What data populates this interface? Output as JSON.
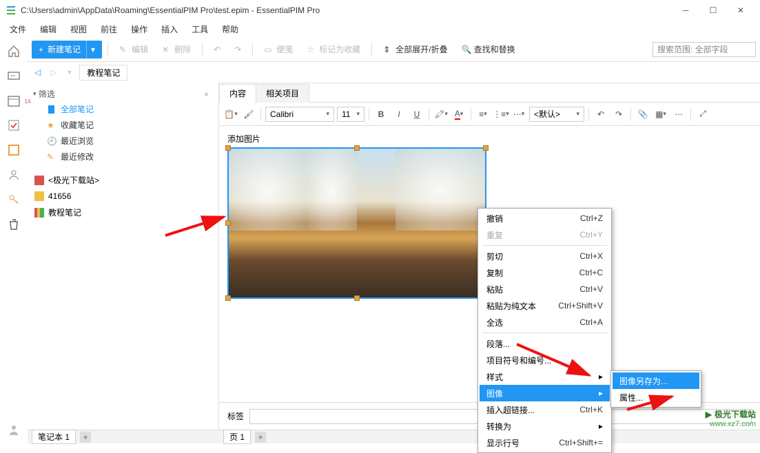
{
  "window": {
    "title": "C:\\Users\\admin\\AppData\\Roaming\\EssentialPIM Pro\\test.epim - EssentialPIM Pro"
  },
  "menu": [
    "文件",
    "编辑",
    "视图",
    "前往",
    "操作",
    "插入",
    "工具",
    "帮助"
  ],
  "toolbar": {
    "new_label": "新建笔记",
    "edit": "编辑",
    "delete": "删除",
    "memo": "便笺",
    "favorite": "标记为收藏",
    "expand": "全部展开/折叠",
    "findreplace": "查找和替换",
    "search_placeholder": "搜索范围: 全部字段"
  },
  "breadcrumb": {
    "current": "教程笔记"
  },
  "sidebar_cal_day": "14",
  "tree": {
    "filter_label": "筛选",
    "items": [
      {
        "label": "全部笔记",
        "color": "blue",
        "icon": "doc"
      },
      {
        "label": "收藏笔记",
        "icon": "star"
      },
      {
        "label": "最近浏览",
        "icon": "recent"
      },
      {
        "label": "最近修改",
        "icon": "edit"
      }
    ],
    "notebooks": [
      {
        "label": "<极光下载站>",
        "icon": "nb-red"
      },
      {
        "label": "41656",
        "icon": "nb-yellow"
      },
      {
        "label": "教程笔记",
        "icon": "nb-rainbow"
      }
    ]
  },
  "editor": {
    "tabs": [
      "内容",
      "相关项目"
    ],
    "font": "Calibri",
    "size": "11",
    "style_select": "<默认>",
    "caption": "添加图片",
    "tags_label": "标签"
  },
  "bottom": {
    "left_tab": "笔记本 1",
    "right_tab": "页 1"
  },
  "context_menu": {
    "items": [
      {
        "label": "撤销",
        "shortcut": "Ctrl+Z"
      },
      {
        "label": "重复",
        "shortcut": "Ctrl+Y",
        "disabled": true
      },
      {
        "sep": true
      },
      {
        "label": "剪切",
        "shortcut": "Ctrl+X"
      },
      {
        "label": "复制",
        "shortcut": "Ctrl+C"
      },
      {
        "label": "粘贴",
        "shortcut": "Ctrl+V"
      },
      {
        "label": "粘贴为纯文本",
        "shortcut": "Ctrl+Shift+V"
      },
      {
        "label": "全选",
        "shortcut": "Ctrl+A"
      },
      {
        "sep": true
      },
      {
        "label": "段落..."
      },
      {
        "label": "项目符号和编号..."
      },
      {
        "label": "样式",
        "submenu": true
      },
      {
        "label": "图像",
        "submenu": true,
        "highlight": true
      },
      {
        "label": "插入超链接...",
        "shortcut": "Ctrl+K"
      },
      {
        "label": "转换为",
        "submenu": true
      },
      {
        "label": "显示行号",
        "shortcut": "Ctrl+Shift+="
      }
    ],
    "sub": [
      {
        "label": "图像另存为...",
        "highlight": true
      },
      {
        "label": "属性..."
      }
    ]
  },
  "watermark": {
    "line1": "极光下载站",
    "line2": "www.xz7.com"
  }
}
